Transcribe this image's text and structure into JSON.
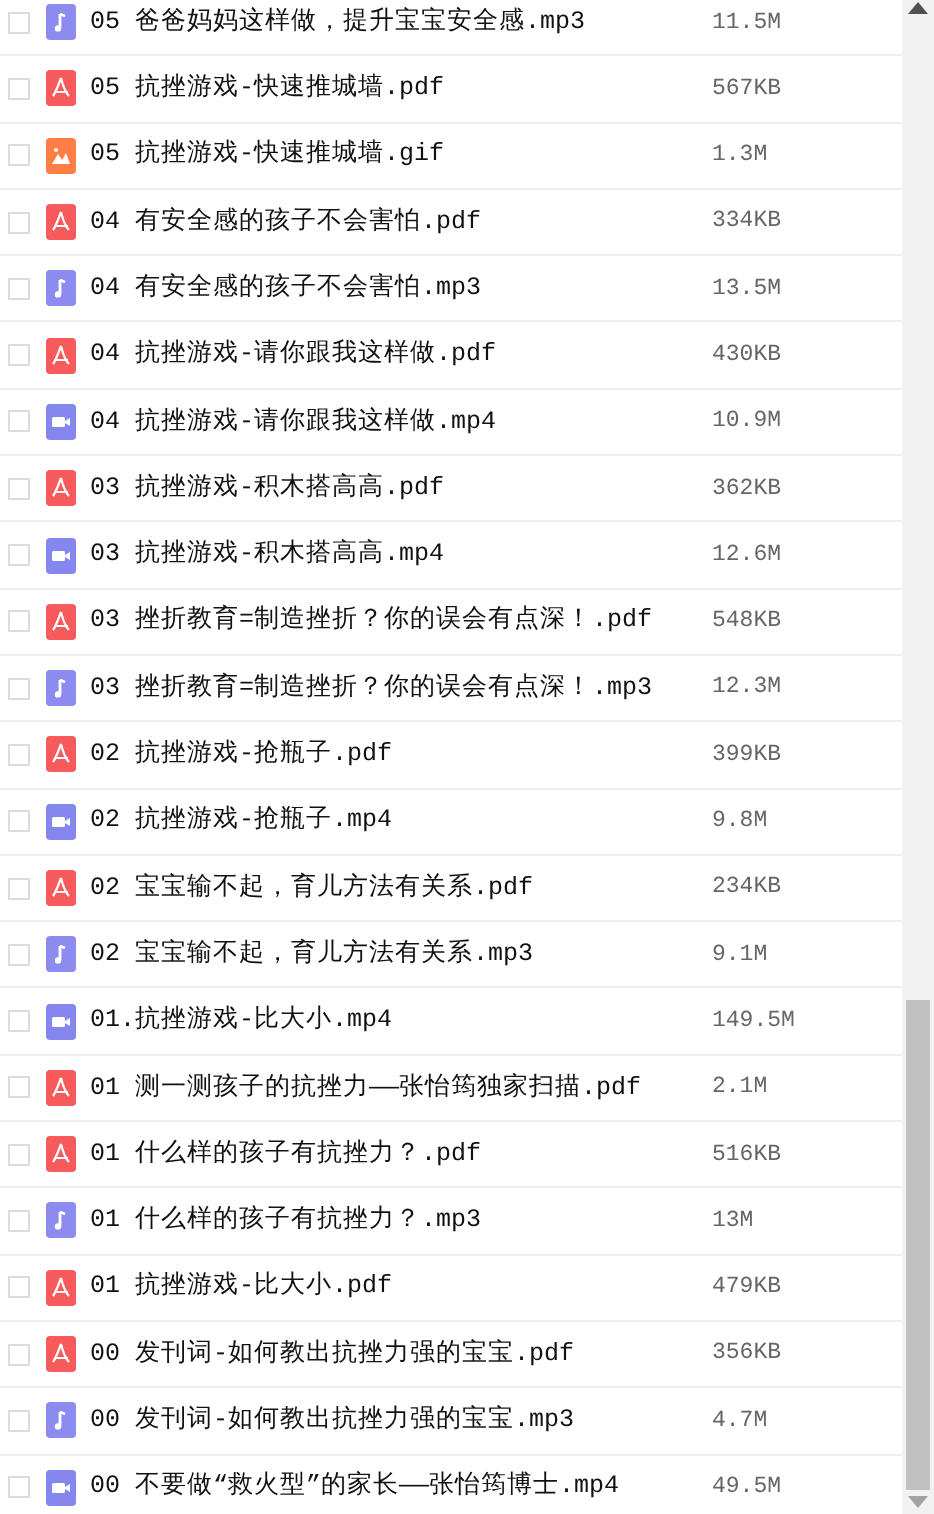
{
  "files": [
    {
      "kind": "audio",
      "checked": false,
      "name": "05 爸爸妈妈这样做，提升宝宝安全感.mp3",
      "size": "11.5M"
    },
    {
      "kind": "pdf",
      "checked": false,
      "name": "05 抗挫游戏-快速推城墙.pdf",
      "size": "567KB"
    },
    {
      "kind": "image",
      "checked": false,
      "name": "05 抗挫游戏-快速推城墙.gif",
      "size": "1.3M"
    },
    {
      "kind": "pdf",
      "checked": false,
      "name": "04 有安全感的孩子不会害怕.pdf",
      "size": "334KB"
    },
    {
      "kind": "audio",
      "checked": false,
      "name": "04 有安全感的孩子不会害怕.mp3",
      "size": "13.5M"
    },
    {
      "kind": "pdf",
      "checked": false,
      "name": "04 抗挫游戏-请你跟我这样做.pdf",
      "size": "430KB"
    },
    {
      "kind": "video",
      "checked": false,
      "name": "04 抗挫游戏-请你跟我这样做.mp4",
      "size": "10.9M"
    },
    {
      "kind": "pdf",
      "checked": false,
      "name": "03 抗挫游戏-积木搭高高.pdf",
      "size": "362KB"
    },
    {
      "kind": "video",
      "checked": false,
      "name": "03 抗挫游戏-积木搭高高.mp4",
      "size": "12.6M"
    },
    {
      "kind": "pdf",
      "checked": false,
      "name": "03 挫折教育=制造挫折？你的误会有点深！.pdf",
      "size": "548KB"
    },
    {
      "kind": "audio",
      "checked": false,
      "name": "03 挫折教育=制造挫折？你的误会有点深！.mp3",
      "size": "12.3M"
    },
    {
      "kind": "pdf",
      "checked": false,
      "name": "02 抗挫游戏-抢瓶子.pdf",
      "size": "399KB"
    },
    {
      "kind": "video",
      "checked": false,
      "name": "02 抗挫游戏-抢瓶子.mp4",
      "size": "9.8M"
    },
    {
      "kind": "pdf",
      "checked": false,
      "name": "02 宝宝输不起，育儿方法有关系.pdf",
      "size": "234KB"
    },
    {
      "kind": "audio",
      "checked": false,
      "name": "02 宝宝输不起，育儿方法有关系.mp3",
      "size": "9.1M"
    },
    {
      "kind": "video",
      "checked": false,
      "name": "01.抗挫游戏-比大小.mp4",
      "size": "149.5M"
    },
    {
      "kind": "pdf",
      "checked": false,
      "name": "01 测一测孩子的抗挫力——张怡筠独家扫描.pdf",
      "size": "2.1M"
    },
    {
      "kind": "pdf",
      "checked": false,
      "name": "01 什么样的孩子有抗挫力？.pdf",
      "size": "516KB"
    },
    {
      "kind": "audio",
      "checked": false,
      "name": "01 什么样的孩子有抗挫力？.mp3",
      "size": "13M"
    },
    {
      "kind": "pdf",
      "checked": false,
      "name": "01 抗挫游戏-比大小.pdf",
      "size": "479KB"
    },
    {
      "kind": "pdf",
      "checked": false,
      "name": "00 发刊词-如何教出抗挫力强的宝宝.pdf",
      "size": "356KB"
    },
    {
      "kind": "audio",
      "checked": false,
      "name": "00 发刊词-如何教出抗挫力强的宝宝.mp3",
      "size": "4.7M"
    },
    {
      "kind": "video",
      "checked": false,
      "name": "00 不要做“救火型”的家长——张怡筠博士.mp4",
      "size": "49.5M"
    }
  ]
}
